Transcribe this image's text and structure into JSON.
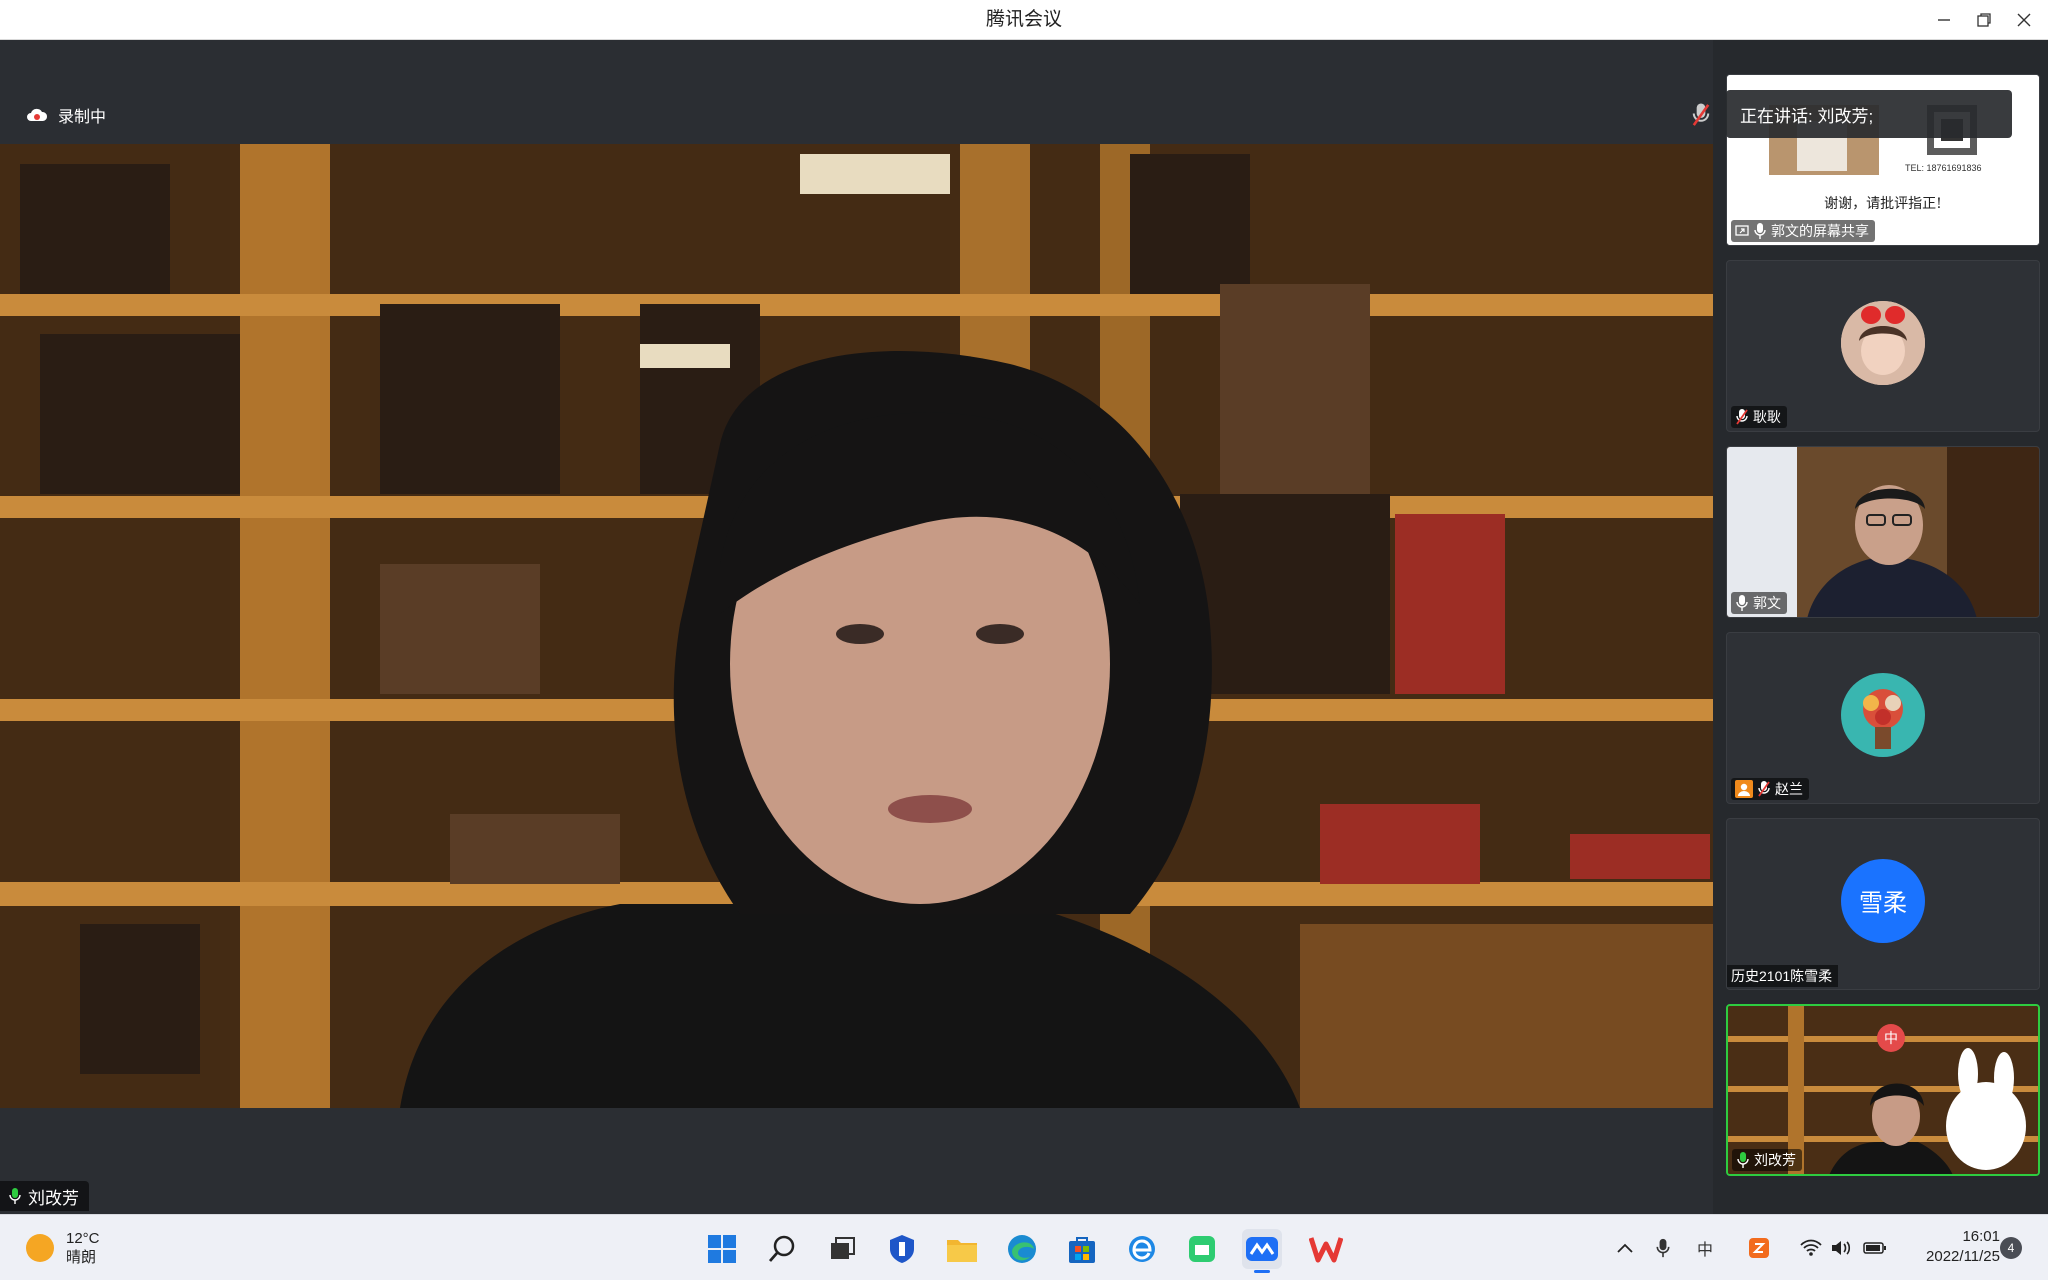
{
  "window": {
    "title": "腾讯会议"
  },
  "stage": {
    "recording_label": "录制中",
    "speaker_name": "刘改芳"
  },
  "speaking_banner": {
    "text": "正在讲话: 刘改芳;"
  },
  "participants": [
    {
      "name": "郭文的屏幕共享",
      "slide_line1": "谢谢，请批评指正!",
      "slide_tel": "TEL: 18761691836",
      "muted": false
    },
    {
      "name": "耿耿",
      "muted": true
    },
    {
      "name": "郭文",
      "muted": false
    },
    {
      "name": "赵兰",
      "muted": true
    },
    {
      "name": "历史2101陈雪柔",
      "avatar_text": "雪柔",
      "muted": false
    },
    {
      "name": "刘改芳",
      "sticker_text": "中",
      "muted": false,
      "active": true
    }
  ],
  "taskbar": {
    "weather_temp": "12°C",
    "weather_desc": "晴朗",
    "time": "16:01",
    "date": "2022/11/25",
    "notification_count": "4",
    "ime_label": "中"
  },
  "colors": {
    "accent": "#1a73ff",
    "speaking_border": "#2ecc40"
  }
}
